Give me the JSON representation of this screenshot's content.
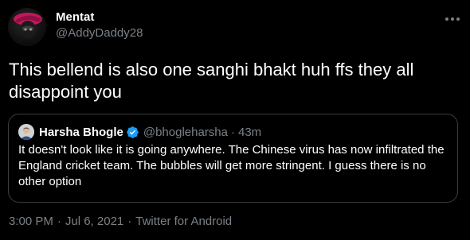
{
  "tweet": {
    "author": {
      "display_name": "Mentat",
      "handle": "@AddyDaddy28",
      "avatar_icon": "masked-figure-avatar"
    },
    "more_icon": "more-horizontal-icon",
    "text": "This bellend is also one sanghi bhakt huh ffs they all disappoint you",
    "quoted": {
      "author": {
        "display_name": "Harsha Bhogle",
        "handle": "@bhogleharsha",
        "verified": true,
        "verified_icon": "verified-badge-icon"
      },
      "separator": "·",
      "time_ago": "43m",
      "text": "It doesn't look like it is going anywhere. The Chinese virus has now infiltrated the England cricket team. The bubbles will get more stringent. I guess there is no other option"
    },
    "meta": {
      "time": "3:00 PM",
      "date": "Jul 6, 2021",
      "source": "Twitter for Android",
      "separator": "·"
    }
  },
  "colors": {
    "background": "#000000",
    "primary_text": "#ffffff",
    "secondary_text": "#7b8187",
    "border": "#3a3d41",
    "verified_blue": "#1d9bf0",
    "avatar_accent": "#c2185b"
  }
}
